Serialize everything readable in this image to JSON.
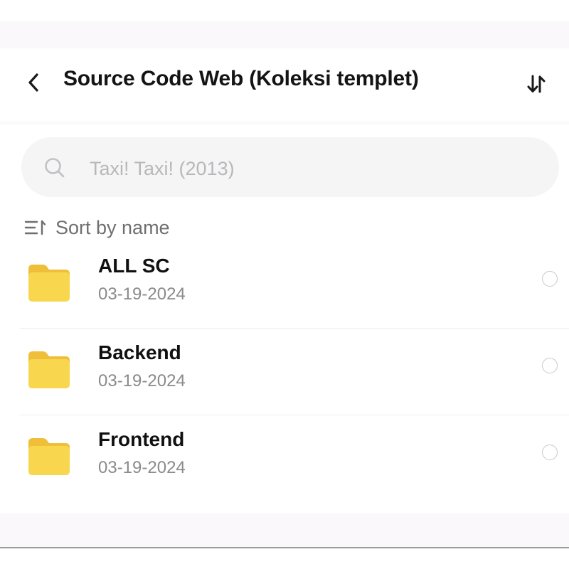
{
  "header": {
    "title": "Source Code Web (Koleksi templet)",
    "back_icon": "chevron-left-icon",
    "sort_toggle_icon": "sort-arrows-icon"
  },
  "search": {
    "placeholder": "Taxi! Taxi! (2013)",
    "icon": "search-icon"
  },
  "sort": {
    "label": "Sort by name",
    "icon": "sort-list-icon"
  },
  "items": [
    {
      "name": "ALL SC",
      "date": "03-19-2024",
      "icon": "folder-icon"
    },
    {
      "name": "Backend",
      "date": "03-19-2024",
      "icon": "folder-icon"
    },
    {
      "name": "Frontend",
      "date": "03-19-2024",
      "icon": "folder-icon"
    }
  ],
  "colors": {
    "folder_yellow": "#f8d64e",
    "folder_tab": "#efbf3a",
    "title_text": "#141414",
    "secondary_text": "#8a8a8c"
  }
}
